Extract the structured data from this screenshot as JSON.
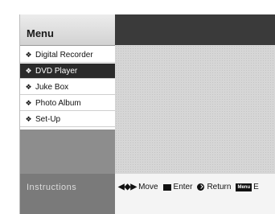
{
  "menu": {
    "title": "Menu",
    "items": [
      {
        "label": "Digital Recorder",
        "selected": false
      },
      {
        "label": "DVD Player",
        "selected": true
      },
      {
        "label": "Juke Box",
        "selected": false
      },
      {
        "label": "Photo Album",
        "selected": false
      },
      {
        "label": "Set-Up",
        "selected": false
      }
    ]
  },
  "instructions": {
    "label": "Instructions",
    "move_label": "Move",
    "enter_label": "Enter",
    "return_label": "Return",
    "menu_key_label": "Menu",
    "trailing_text": "E"
  },
  "icons": {
    "bullet": "diamond-bullet-icon",
    "move": "four-way-arrows-icon",
    "enter": "enter-key-icon",
    "return": "return-circle-icon",
    "menu_key": "menu-key-icon"
  },
  "colors": {
    "selected_bg": "#2b2b2b",
    "header_dark": "#3a3a3a",
    "instructions_bg": "#7a7a7a"
  }
}
